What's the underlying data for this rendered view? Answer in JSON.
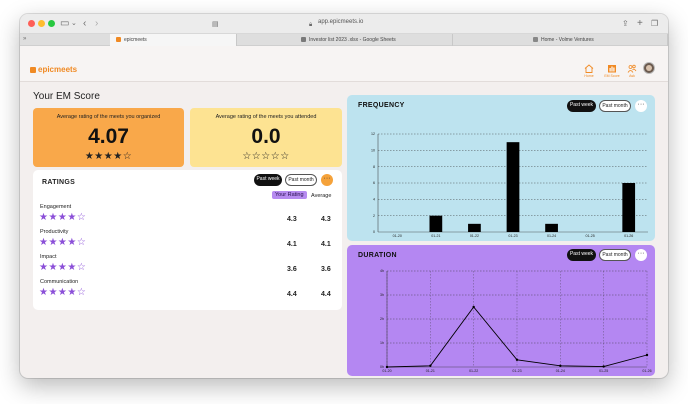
{
  "browser": {
    "url": "app.epicmeets.io",
    "tabs": [
      {
        "label": "epicmeets",
        "active": true
      },
      {
        "label": "Investor list 2023 .xlsx - Google Sheets",
        "active": false
      },
      {
        "label": "Home - Volme Ventures",
        "active": false
      }
    ]
  },
  "app": {
    "logo": "epicmeets",
    "brand_color": "#f08a24",
    "nav": [
      {
        "label": "Home",
        "icon": "home-icon"
      },
      {
        "label": "EM Score",
        "icon": "bar-chart-icon"
      },
      {
        "label": "Ask",
        "icon": "people-icon"
      }
    ]
  },
  "page": {
    "title": "Your EM Score"
  },
  "scores": {
    "organized": {
      "label": "Average rating of the meets you organized",
      "value": "4.07",
      "stars": "★★★★☆",
      "color": "#f9a84a"
    },
    "attended": {
      "label": "Average rating of the meets you attended",
      "value": "0.0",
      "stars": "☆☆☆☆☆",
      "color": "#fde392"
    }
  },
  "ratings": {
    "title": "RATINGS",
    "filter_active": "Past week",
    "filter_inactive": "Past month",
    "more": "···",
    "col_your_rating": "Your Rating",
    "col_average": "Average",
    "rows": [
      {
        "name": "Engagement",
        "stars": "★★★★☆",
        "your": "4.3",
        "avg": "4.3"
      },
      {
        "name": "Productivity",
        "stars": "★★★★☆",
        "your": "4.1",
        "avg": "4.1"
      },
      {
        "name": "Impact",
        "stars": "★★★★☆",
        "your": "3.6",
        "avg": "3.6"
      },
      {
        "name": "Communication",
        "stars": "★★★★☆",
        "your": "4.4",
        "avg": "4.4"
      }
    ]
  },
  "frequency": {
    "title": "FREQUENCY",
    "filter_active": "Past week",
    "filter_inactive": "Past month",
    "more": "···",
    "bg": "#bde3ef"
  },
  "duration": {
    "title": "DURATION",
    "filter_active": "Past week",
    "filter_inactive": "Past month",
    "more": "···",
    "bg": "#b487f2"
  },
  "chart_data": [
    {
      "type": "bar",
      "categories": [
        "01-20",
        "01-21",
        "01-22",
        "01-23",
        "01-24",
        "01-25",
        "01-26"
      ],
      "values": [
        0,
        2,
        1,
        11,
        1,
        0,
        6
      ],
      "ylim": [
        0,
        12
      ],
      "yticks": [
        "0",
        "2",
        "4",
        "6",
        "8",
        "10",
        "12"
      ],
      "title": "",
      "xlabel": "",
      "ylabel": "",
      "grid": true
    },
    {
      "type": "line",
      "categories": [
        "01-20",
        "01-21",
        "01-22",
        "01-23",
        "01-24",
        "01-25",
        "01-26"
      ],
      "values": [
        0,
        0.05,
        2.5,
        0.3,
        0.05,
        0.02,
        0.5
      ],
      "ylim": [
        0,
        4
      ],
      "yticks": [
        "0h",
        "1h",
        "2h",
        "3h",
        "4h"
      ],
      "title": "",
      "xlabel": "",
      "ylabel": "",
      "grid": true
    }
  ]
}
